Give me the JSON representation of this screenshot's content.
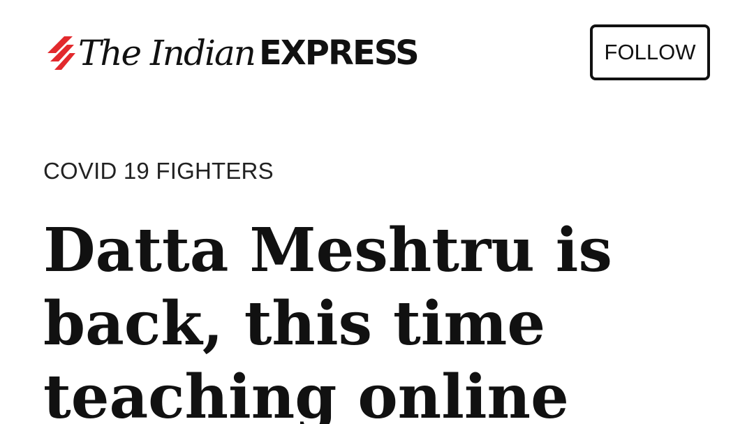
{
  "header": {
    "logo": {
      "part1": "The Indian",
      "part2": "EXPRESS",
      "mark_icon": "indian-express-logo-mark-icon",
      "mark_color": "#e2292d"
    },
    "follow_label": "FOLLOW"
  },
  "article": {
    "category": "COVID 19 FIGHTERS",
    "headline_lines": [
      "Datta Meshtru is",
      "back, this time",
      "teaching online"
    ]
  }
}
